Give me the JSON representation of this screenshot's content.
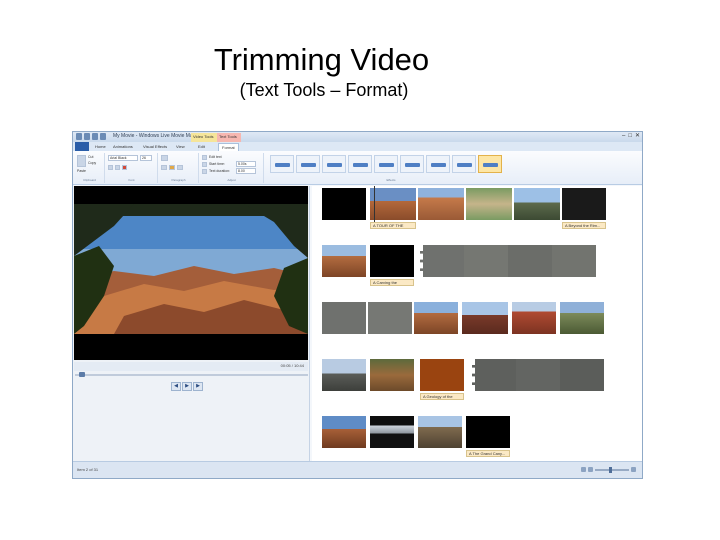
{
  "slide": {
    "title": "Trimming Video",
    "subtitle": "(Text Tools – Format)"
  },
  "window": {
    "title": "My Movie - Windows Live Movie Maker",
    "context_tabs": [
      "Video Tools",
      "Text Tools"
    ]
  },
  "ribbon": {
    "file_tab": "",
    "tabs": [
      "Home",
      "Animations",
      "Visual Effects",
      "View",
      "Edit",
      "Format"
    ],
    "active_tab": "Format",
    "groups": [
      "Clipboard",
      "Font",
      "Paragraph",
      "Adjust",
      "Effects"
    ],
    "clipboard": {
      "cut": "Cut",
      "copy": "Copy",
      "paste": "Paste"
    },
    "font": {
      "family": "Arial Black",
      "size": "26"
    },
    "adjust": {
      "start_time_label": "Start time:",
      "start_time": "5.00s",
      "text_duration_label": "Text duration:",
      "text_duration": "8.00",
      "edit_text": "Edit text"
    }
  },
  "preview": {
    "time": "00:05 / 10:44"
  },
  "storyboard": {
    "captions": [
      "A TOUR OF THE",
      "A Carving the",
      "A Geology of the",
      "A The Grand Cany...",
      "A Beyond the Rim..."
    ]
  },
  "status": {
    "text": "Item 2 of 31"
  },
  "colors": {
    "accent": "#2a5da8",
    "caption_bg": "#fbe9c5",
    "selected_effect": "#fde6a5"
  }
}
